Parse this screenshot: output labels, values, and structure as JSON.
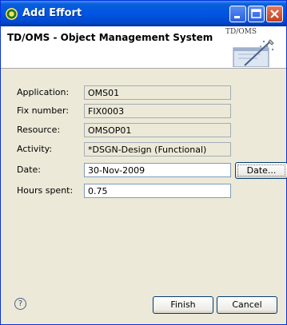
{
  "window": {
    "title": "Add Effort"
  },
  "header": {
    "title": "TD/OMS - Object Management System",
    "banner_label": "TD/OMS"
  },
  "form": {
    "application": {
      "label": "Application:",
      "value": "OMS01"
    },
    "fix_number": {
      "label": "Fix number:",
      "value": "FIX0003"
    },
    "resource": {
      "label": "Resource:",
      "value": "OMSOP01"
    },
    "activity": {
      "label": "Activity:",
      "value": "*DSGN-Design (Functional)"
    },
    "date": {
      "label": "Date:",
      "value": "30-Nov-2009",
      "button_label": "Date..."
    },
    "hours": {
      "label": "Hours spent:",
      "value": "0.75"
    }
  },
  "footer": {
    "help_icon": "?",
    "finish_label": "Finish",
    "cancel_label": "Cancel"
  },
  "colors": {
    "titlebar": "#0055e5",
    "dialog_bg": "#ece9d8",
    "close_button": "#c1401e"
  },
  "icons": {
    "window": "app-icon",
    "minimize": "minimize-icon",
    "maximize": "maximize-icon",
    "close": "close-icon",
    "help": "help-icon",
    "banner": "wizard-banner-icon"
  }
}
